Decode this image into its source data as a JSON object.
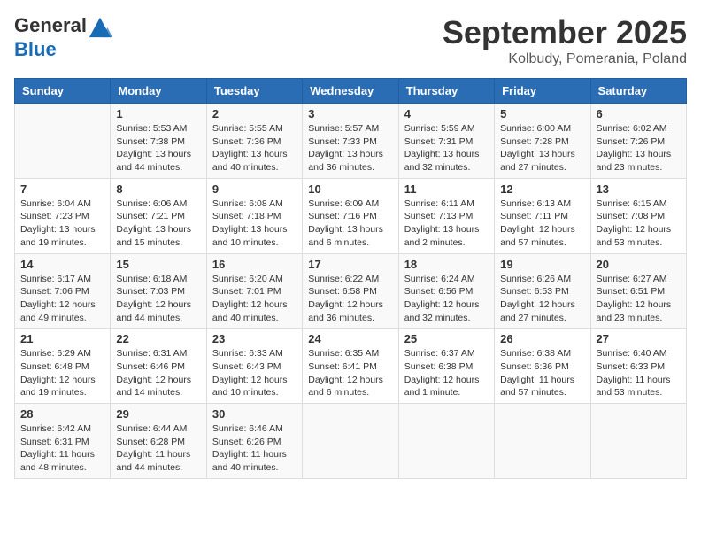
{
  "header": {
    "logo_line1": "General",
    "logo_line2": "Blue",
    "month": "September 2025",
    "location": "Kolbudy, Pomerania, Poland"
  },
  "days_of_week": [
    "Sunday",
    "Monday",
    "Tuesday",
    "Wednesday",
    "Thursday",
    "Friday",
    "Saturday"
  ],
  "weeks": [
    [
      {
        "day": "",
        "info": ""
      },
      {
        "day": "1",
        "info": "Sunrise: 5:53 AM\nSunset: 7:38 PM\nDaylight: 13 hours and 44 minutes."
      },
      {
        "day": "2",
        "info": "Sunrise: 5:55 AM\nSunset: 7:36 PM\nDaylight: 13 hours and 40 minutes."
      },
      {
        "day": "3",
        "info": "Sunrise: 5:57 AM\nSunset: 7:33 PM\nDaylight: 13 hours and 36 minutes."
      },
      {
        "day": "4",
        "info": "Sunrise: 5:59 AM\nSunset: 7:31 PM\nDaylight: 13 hours and 32 minutes."
      },
      {
        "day": "5",
        "info": "Sunrise: 6:00 AM\nSunset: 7:28 PM\nDaylight: 13 hours and 27 minutes."
      },
      {
        "day": "6",
        "info": "Sunrise: 6:02 AM\nSunset: 7:26 PM\nDaylight: 13 hours and 23 minutes."
      }
    ],
    [
      {
        "day": "7",
        "info": "Sunrise: 6:04 AM\nSunset: 7:23 PM\nDaylight: 13 hours and 19 minutes."
      },
      {
        "day": "8",
        "info": "Sunrise: 6:06 AM\nSunset: 7:21 PM\nDaylight: 13 hours and 15 minutes."
      },
      {
        "day": "9",
        "info": "Sunrise: 6:08 AM\nSunset: 7:18 PM\nDaylight: 13 hours and 10 minutes."
      },
      {
        "day": "10",
        "info": "Sunrise: 6:09 AM\nSunset: 7:16 PM\nDaylight: 13 hours and 6 minutes."
      },
      {
        "day": "11",
        "info": "Sunrise: 6:11 AM\nSunset: 7:13 PM\nDaylight: 13 hours and 2 minutes."
      },
      {
        "day": "12",
        "info": "Sunrise: 6:13 AM\nSunset: 7:11 PM\nDaylight: 12 hours and 57 minutes."
      },
      {
        "day": "13",
        "info": "Sunrise: 6:15 AM\nSunset: 7:08 PM\nDaylight: 12 hours and 53 minutes."
      }
    ],
    [
      {
        "day": "14",
        "info": "Sunrise: 6:17 AM\nSunset: 7:06 PM\nDaylight: 12 hours and 49 minutes."
      },
      {
        "day": "15",
        "info": "Sunrise: 6:18 AM\nSunset: 7:03 PM\nDaylight: 12 hours and 44 minutes."
      },
      {
        "day": "16",
        "info": "Sunrise: 6:20 AM\nSunset: 7:01 PM\nDaylight: 12 hours and 40 minutes."
      },
      {
        "day": "17",
        "info": "Sunrise: 6:22 AM\nSunset: 6:58 PM\nDaylight: 12 hours and 36 minutes."
      },
      {
        "day": "18",
        "info": "Sunrise: 6:24 AM\nSunset: 6:56 PM\nDaylight: 12 hours and 32 minutes."
      },
      {
        "day": "19",
        "info": "Sunrise: 6:26 AM\nSunset: 6:53 PM\nDaylight: 12 hours and 27 minutes."
      },
      {
        "day": "20",
        "info": "Sunrise: 6:27 AM\nSunset: 6:51 PM\nDaylight: 12 hours and 23 minutes."
      }
    ],
    [
      {
        "day": "21",
        "info": "Sunrise: 6:29 AM\nSunset: 6:48 PM\nDaylight: 12 hours and 19 minutes."
      },
      {
        "day": "22",
        "info": "Sunrise: 6:31 AM\nSunset: 6:46 PM\nDaylight: 12 hours and 14 minutes."
      },
      {
        "day": "23",
        "info": "Sunrise: 6:33 AM\nSunset: 6:43 PM\nDaylight: 12 hours and 10 minutes."
      },
      {
        "day": "24",
        "info": "Sunrise: 6:35 AM\nSunset: 6:41 PM\nDaylight: 12 hours and 6 minutes."
      },
      {
        "day": "25",
        "info": "Sunrise: 6:37 AM\nSunset: 6:38 PM\nDaylight: 12 hours and 1 minute."
      },
      {
        "day": "26",
        "info": "Sunrise: 6:38 AM\nSunset: 6:36 PM\nDaylight: 11 hours and 57 minutes."
      },
      {
        "day": "27",
        "info": "Sunrise: 6:40 AM\nSunset: 6:33 PM\nDaylight: 11 hours and 53 minutes."
      }
    ],
    [
      {
        "day": "28",
        "info": "Sunrise: 6:42 AM\nSunset: 6:31 PM\nDaylight: 11 hours and 48 minutes."
      },
      {
        "day": "29",
        "info": "Sunrise: 6:44 AM\nSunset: 6:28 PM\nDaylight: 11 hours and 44 minutes."
      },
      {
        "day": "30",
        "info": "Sunrise: 6:46 AM\nSunset: 6:26 PM\nDaylight: 11 hours and 40 minutes."
      },
      {
        "day": "",
        "info": ""
      },
      {
        "day": "",
        "info": ""
      },
      {
        "day": "",
        "info": ""
      },
      {
        "day": "",
        "info": ""
      }
    ]
  ]
}
